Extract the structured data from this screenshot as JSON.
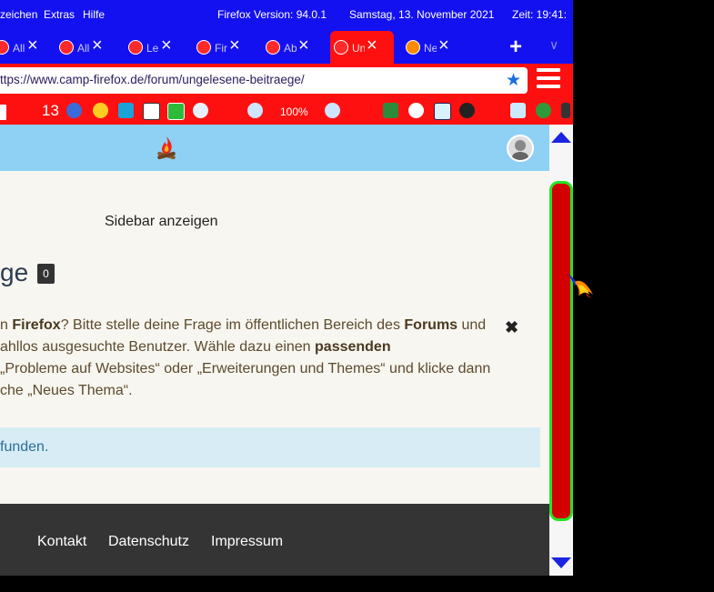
{
  "menubar": {
    "items": [
      "zeichen",
      "Extras",
      "Hilfe"
    ],
    "version": "Firefox Version: 94.0.1",
    "date": "Samstag, 13. November 2021",
    "time": "Zeit:  19:41:"
  },
  "tabs": [
    {
      "label": "Alle"
    },
    {
      "label": "Alle"
    },
    {
      "label": "Les"
    },
    {
      "label": "Fir"
    },
    {
      "label": "Ab"
    },
    {
      "label": "Un",
      "active": true
    },
    {
      "label": "Ne"
    }
  ],
  "newtab_symbol": "+",
  "tablist_symbol": "∨",
  "url": "ttps://www.camp-firefox.de/forum/ungelesene-beitraege/",
  "bookmarks": {
    "count": "13",
    "zoom": "100%"
  },
  "page": {
    "sidebar_toggle": "Sidebar anzeigen",
    "heading": "ge",
    "badge": "0",
    "notice_lines": [
      {
        "parts": [
          {
            "t": "n ",
            "b": false
          },
          {
            "t": "Firefox",
            "b": true
          },
          {
            "t": "? Bitte stelle deine Frage im öffentlichen Bereich des ",
            "b": false
          },
          {
            "t": "Forums",
            "b": true
          },
          {
            "t": " und",
            "b": false
          }
        ]
      },
      {
        "parts": [
          {
            "t": "ahllos ausgesuchte Benutzer. Wähle dazu einen ",
            "b": false
          },
          {
            "t": "passenden",
            "b": true
          }
        ]
      },
      {
        "parts": [
          {
            "t": "„Probleme auf Websites“ oder „Erweiterungen und Themes“ und klicke dann",
            "b": false
          }
        ]
      },
      {
        "parts": [
          {
            "t": "che „Neues Thema“.",
            "b": false
          }
        ]
      }
    ],
    "dismiss_symbol": "✖",
    "info": "funden.",
    "footer_links": [
      "Kontakt",
      "Datenschutz",
      "Impressum"
    ]
  },
  "colors": {
    "menubar": "#1411f0",
    "toolbar": "#ff1010",
    "header": "#8fd0f5",
    "scroll_thumb": "#d20000",
    "scroll_border": "#27e327"
  }
}
